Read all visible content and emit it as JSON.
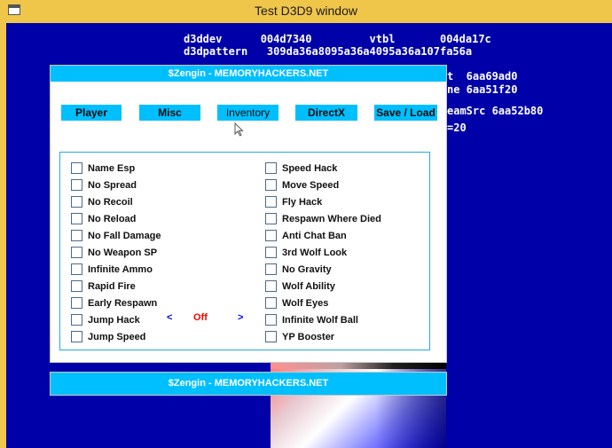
{
  "window": {
    "title": "Test D3D9 window"
  },
  "debug": {
    "line1": "d3ddev      004d7340         vtbl       004da17c",
    "line2": "d3dpattern   309da36a8095a36a4095a36a107fa56a",
    "line3": "t  6aa69ad0",
    "line4": "ne 6aa51f20",
    "line5": "eamSrc 6aa52b80",
    "line6": "=20"
  },
  "panel": {
    "title": "$Zengin   - MEMORYHACKERS.NET",
    "tabs": [
      "Player",
      "Misc",
      "Inventory",
      "DirectX",
      "Save / Load"
    ],
    "left_options": [
      "Name Esp",
      "No Spread",
      "No Recoil",
      "No Reload",
      "No Fall Damage",
      "No Weapon SP",
      "Infinite Ammo",
      "Rapid Fire",
      "Early Respawn",
      "Jump Hack",
      "Jump Speed"
    ],
    "right_options": [
      "Speed Hack",
      "Move Speed",
      "Fly Hack",
      "Respawn Where Died",
      "Anti Chat Ban",
      "3rd Wolf Look",
      "No Gravity",
      "Wolf Ability",
      "Wolf Eyes",
      "Infinite Wolf Ball",
      "YP Booster"
    ],
    "jump_hack": {
      "prev": "<",
      "value": "Off",
      "next": ">"
    }
  },
  "panel2": {
    "title": "$Zengin   - MEMORYHACKERS.NET"
  },
  "colors": {
    "accent": "#00bfff",
    "background": "#0000a8",
    "titlebar": "#f0c64a",
    "off": "#ff0000",
    "arrow": "#0000ee"
  }
}
